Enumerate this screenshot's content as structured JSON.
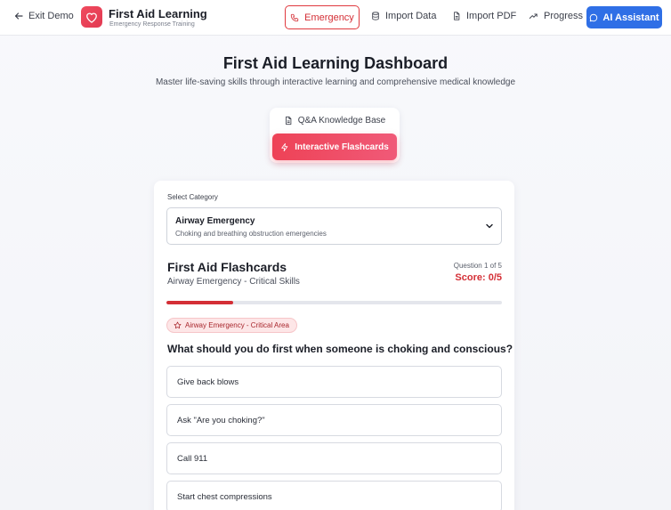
{
  "header": {
    "exit_label": "Exit Demo",
    "brand_title": "First Aid Learning",
    "brand_subtitle": "Emergency Response Training",
    "emergency_label": "Emergency",
    "import_data_label": "Import Data",
    "import_pdf_label": "Import PDF",
    "progress_label": "Progress",
    "ai_label": "AI Assistant"
  },
  "page": {
    "title": "First Aid Learning Dashboard",
    "subtitle": "Master life-saving skills through interactive learning and comprehensive medical knowledge"
  },
  "modes": {
    "qa_label": "Q&A Knowledge Base",
    "flashcards_label": "Interactive Flashcards",
    "active": "flashcards"
  },
  "category": {
    "label": "Select Category",
    "selected_title": "Airway Emergency",
    "selected_desc": "Choking and breathing obstruction emergencies"
  },
  "flashcards": {
    "title": "First Aid Flashcards",
    "subtitle": "Airway Emergency - Critical Skills",
    "question_counter": "Question 1 of 5",
    "score": "Score: 0/5",
    "progress_fraction": 0.2,
    "badge": "Airway Emergency - Critical Area",
    "question": "What should you do first when someone is choking and conscious?",
    "options": [
      "Give back blows",
      "Ask \"Are you choking?\"",
      "Call 911",
      "Start chest compressions"
    ]
  },
  "colors": {
    "accent_red": "#d42f36",
    "primary_blue": "#2f6fe6",
    "flash_gradient_start": "#ee4256",
    "flash_gradient_end": "#f05a78"
  },
  "icons": {
    "exit": "arrow-left-icon",
    "logo": "heart-icon",
    "emergency": "phone-icon",
    "import_data": "database-icon",
    "import_pdf": "file-icon",
    "progress": "trending-up-icon",
    "ai": "chat-bubble-icon",
    "qa": "document-icon",
    "flashcards": "lightning-icon",
    "select": "chevron-down-icon",
    "badge": "star-icon"
  }
}
